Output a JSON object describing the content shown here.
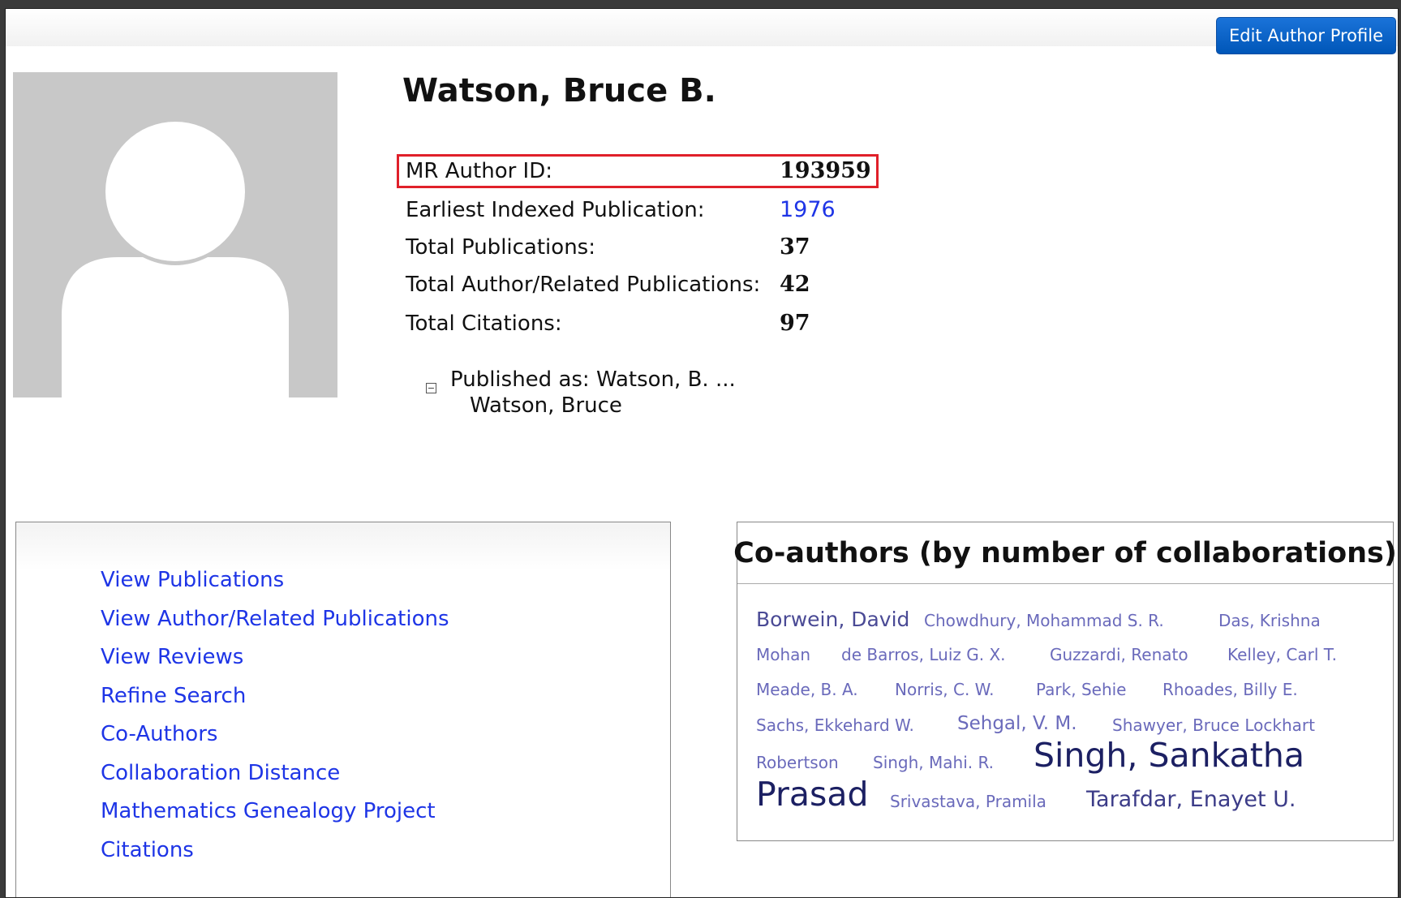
{
  "header": {
    "edit_button_label": "Edit Author Profile"
  },
  "author": {
    "name": "Watson, Bruce B.",
    "info": [
      {
        "label": "MR Author ID:",
        "value": "193959"
      },
      {
        "label": "Earliest Indexed Publication:",
        "value": "1976"
      },
      {
        "label": "Total Publications:",
        "value": "37"
      },
      {
        "label": "Total Author/Related Publications:",
        "value": "42"
      },
      {
        "label": "Total Citations:",
        "value": "97"
      }
    ],
    "published_as_label": "Published as: Watson, B. ...",
    "published_as_names": [
      "Watson, Bruce"
    ],
    "collapse_symbol": "⊟"
  },
  "links": [
    "View Publications",
    "View Author/Related Publications",
    "View Reviews",
    "Refine Search",
    "Co-Authors",
    "Collaboration Distance",
    "Mathematics Genealogy Project",
    "Citations"
  ],
  "coauthors": {
    "title": "Co-authors (by number of collaborations)",
    "names": [
      "Borwein, David",
      "Chowdhury, Mohammad S. R.",
      "Das, Krishna",
      "Mohan",
      "de Barros, Luiz G. X.",
      "Guzzardi, Renato",
      "Kelley, Carl T.",
      "Meade, B. A.",
      "Norris, C. W.",
      "Park, Sehie",
      "Rhoades, Billy E.",
      "Sachs, Ekkehard W.",
      "Sehgal, V. M.",
      "Shawyer, Bruce Lockhart",
      "Robertson",
      "Singh, Mahi. R.",
      "Singh, Sankatha",
      "Prasad",
      "Srivastava, Pramila",
      "Tarafdar, Enayet U."
    ]
  }
}
